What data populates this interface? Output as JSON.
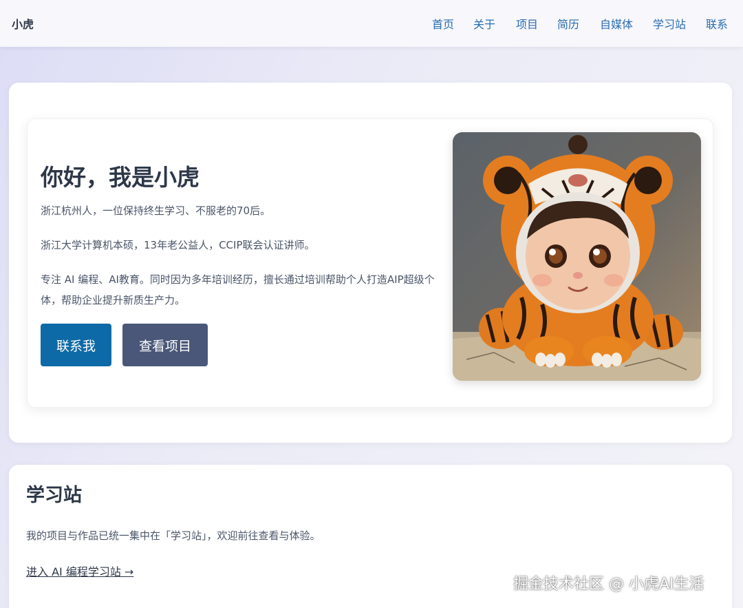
{
  "header": {
    "brand": "小虎",
    "nav": [
      "首页",
      "关于",
      "项目",
      "简历",
      "自媒体",
      "学习站",
      "联系"
    ]
  },
  "hero": {
    "title": "你好，我是小虎",
    "paragraphs": [
      "浙江杭州人，一位保持终生学习、不服老的70后。",
      "浙江大学计算机本硕，13年老公益人，CCIP联会认证讲师。",
      "专注 AI 编程、AI教育。同时因为多年培训经历，擅长通过培训帮助个人打造AIP超级个体，帮助企业提升新质生产力。"
    ],
    "primary_button": "联系我",
    "secondary_button": "查看项目"
  },
  "learn": {
    "title": "学习站",
    "text": "我的项目与作品已统一集中在「学习站」，欢迎前往查看与体验。",
    "link": "进入 AI 编程学习站 →"
  },
  "watermark": "掘金技术社区 @ 小虎AI生活",
  "colors": {
    "nav_link": "#2b6cb0",
    "primary_button": "#0e6aa6",
    "secondary_button": "#4a5778"
  }
}
